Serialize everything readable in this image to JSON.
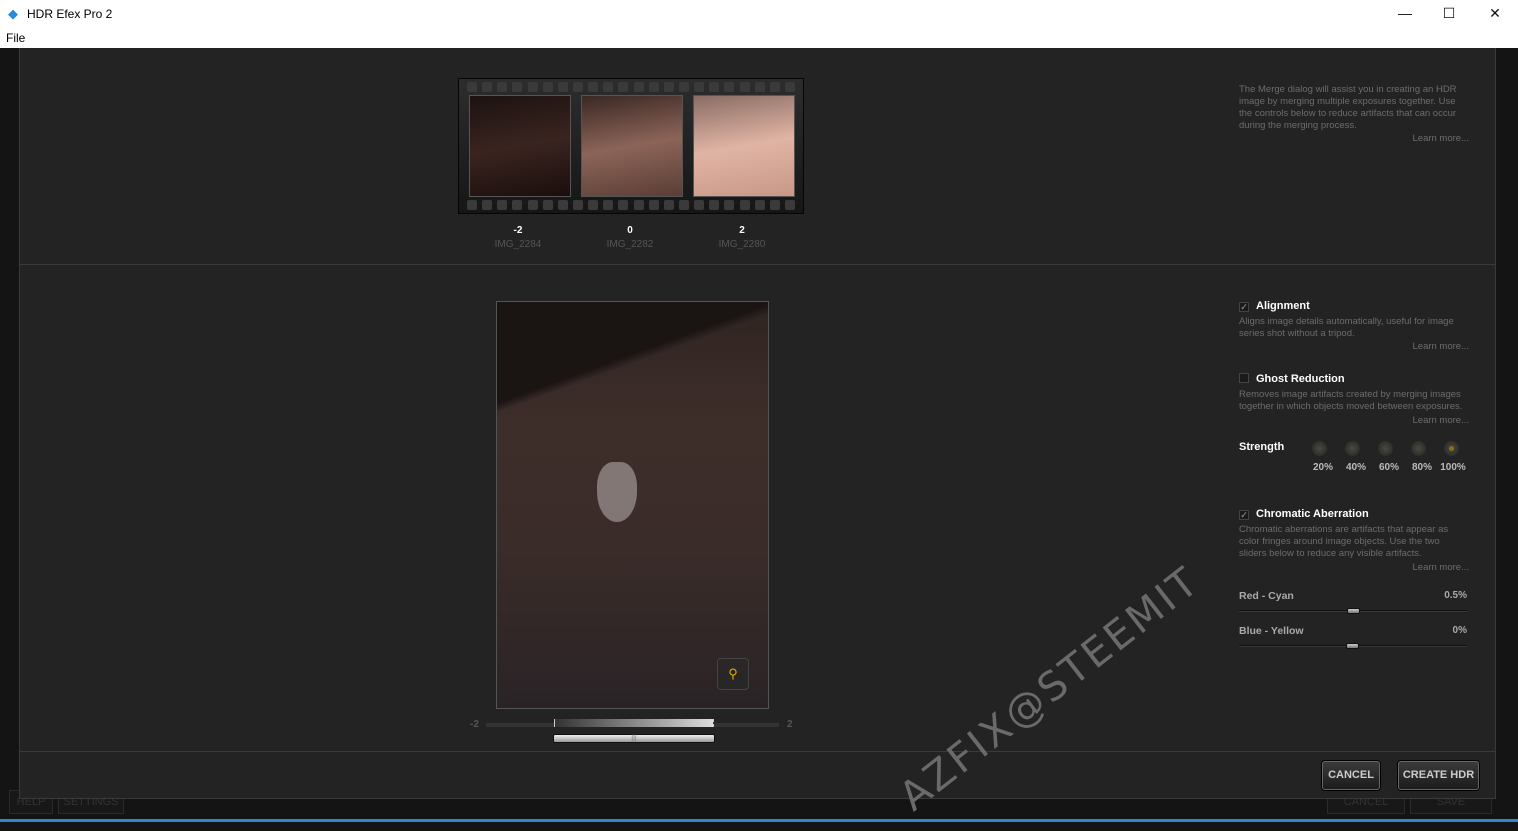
{
  "window": {
    "title": "HDR Efex Pro 2",
    "minimize": "—",
    "maximize": "☐",
    "close": "✕"
  },
  "menu": {
    "file": "File"
  },
  "background_buttons": {
    "help": "HELP",
    "settings": "SETTINGS",
    "cancel": "CANCEL",
    "save": "SAVE"
  },
  "exposures": [
    {
      "ev": "-2",
      "name": "IMG_2284"
    },
    {
      "ev": "0",
      "name": "IMG_2282"
    },
    {
      "ev": "2",
      "name": "IMG_2280"
    }
  ],
  "intro": {
    "text": "The Merge dialog will assist you in creating an HDR image by merging multiple exposures together. Use the controls below to reduce artifacts that can occur during the merging process.",
    "learn": "Learn more..."
  },
  "alignment": {
    "label": "Alignment",
    "checked": true,
    "desc": "Aligns image details automatically, useful for image series shot without a tripod.",
    "learn": "Learn more..."
  },
  "ghost": {
    "label": "Ghost Reduction",
    "checked": false,
    "desc": "Removes image artifacts created by merging images together in which objects moved between exposures.",
    "learn": "Learn more...",
    "strength_label": "Strength",
    "levels": [
      "20%",
      "40%",
      "60%",
      "80%",
      "100%"
    ],
    "selected": "100%"
  },
  "chromatic": {
    "label": "Chromatic Aberration",
    "checked": true,
    "desc": "Chromatic aberrations are artifacts that appear as color fringes around image objects. Use the two sliders below to reduce any visible artifacts.",
    "learn": "Learn more...",
    "red_cyan": {
      "label": "Red - Cyan",
      "value": "0.5%"
    },
    "blue_yellow": {
      "label": "Blue - Yellow",
      "value": "0%"
    }
  },
  "ev_range": {
    "min": "-2",
    "max": "2"
  },
  "icons": {
    "zoom": "magnifier-icon",
    "check": "checkmark-icon"
  },
  "buttons": {
    "cancel": "CANCEL",
    "create": "CREATE HDR"
  },
  "watermark": "AZFIX@STEEMIT"
}
